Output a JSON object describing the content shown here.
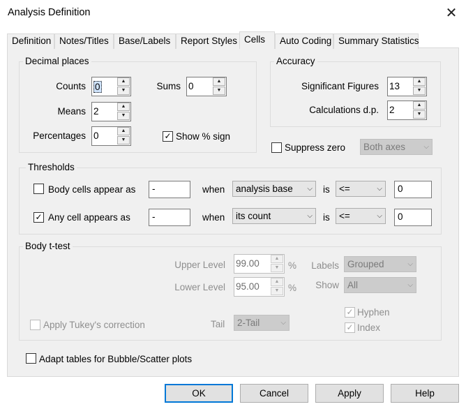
{
  "window": {
    "title": "Analysis Definition",
    "close_glyph": "✕"
  },
  "tabs": [
    "Definition",
    "Notes/Titles",
    "Base/Labels",
    "Report Styles",
    "Cells",
    "Auto Coding",
    "Summary Statistics"
  ],
  "active_tab": "Cells",
  "decimal_places": {
    "title": "Decimal places",
    "counts_label": "Counts",
    "counts_value": "0",
    "means_label": "Means",
    "means_value": "2",
    "percentages_label": "Percentages",
    "percentages_value": "0",
    "sums_label": "Sums",
    "sums_value": "0",
    "show_pct_label": "Show % sign",
    "show_pct_checked": true
  },
  "accuracy": {
    "title": "Accuracy",
    "sig_label": "Significant Figures",
    "sig_value": "13",
    "calc_label": "Calculations d.p.",
    "calc_value": "2"
  },
  "suppress_zero": {
    "label": "Suppress zero",
    "checked": false,
    "combo_value": "Both axes"
  },
  "thresholds": {
    "title": "Thresholds",
    "rows": [
      {
        "label": "Body cells appear as",
        "checked": false,
        "text": "-",
        "when": "when",
        "combo": "analysis base",
        "is": "is",
        "op": "<=",
        "value": "0"
      },
      {
        "label": "Any cell appears as",
        "checked": true,
        "text": "-",
        "when": "when",
        "combo": "its count",
        "is": "is",
        "op": "<=",
        "value": "0"
      }
    ]
  },
  "ttest": {
    "title": "Body t-test",
    "upper_label": "Upper Level",
    "upper_value": "99.00",
    "lower_label": "Lower Level",
    "lower_value": "95.00",
    "pct": "%",
    "labels_label": "Labels",
    "labels_value": "Grouped",
    "show_label": "Show",
    "show_value": "All",
    "hyphen_label": "Hyphen",
    "index_label": "Index",
    "tukey_label": "Apply Tukey's correction",
    "tail_label": "Tail",
    "tail_value": "2-Tail"
  },
  "adapt_label": "Adapt tables for Bubble/Scatter plots",
  "buttons": {
    "ok": "OK",
    "cancel": "Cancel",
    "apply": "Apply",
    "help": "Help"
  },
  "glyphs": {
    "check": "✓",
    "up": "▲",
    "down": "▼",
    "dropdown": "⌵"
  }
}
